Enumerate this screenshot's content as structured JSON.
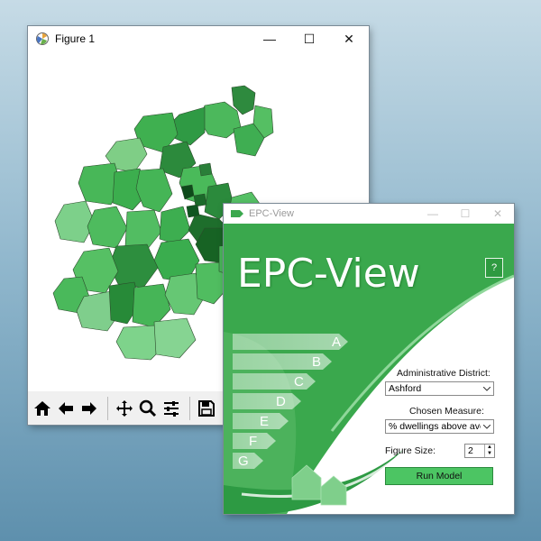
{
  "figure_window": {
    "title": "Figure 1",
    "controls": {
      "minimize": "—",
      "maximize": "☐",
      "close": "✕"
    },
    "toolbar": [
      "home-icon",
      "back-arrow-icon",
      "forward-arrow-icon",
      "pan-icon",
      "zoom-icon",
      "configure-subplots-icon",
      "save-icon"
    ]
  },
  "epc_window": {
    "title": "EPC-View",
    "controls": {
      "minimize": "—",
      "maximize": "☐",
      "close": "✕"
    },
    "banner_title": "EPC-View",
    "help_label": "?",
    "rating_bands": [
      "A",
      "B",
      "C",
      "D",
      "E",
      "F",
      "G"
    ],
    "district": {
      "label": "Administrative District:",
      "value": "Ashford"
    },
    "measure": {
      "label": "Chosen Measure:",
      "value": "% dwellings above avera"
    },
    "figure_size": {
      "label": "Figure Size:",
      "value": "2"
    },
    "run_label": "Run Model",
    "colors": {
      "accent": "#3aa84d",
      "light": "#8fd79a",
      "dark": "#1e7a33"
    }
  },
  "map": {
    "legend": "choropleth of local authority districts shaded in greens"
  }
}
